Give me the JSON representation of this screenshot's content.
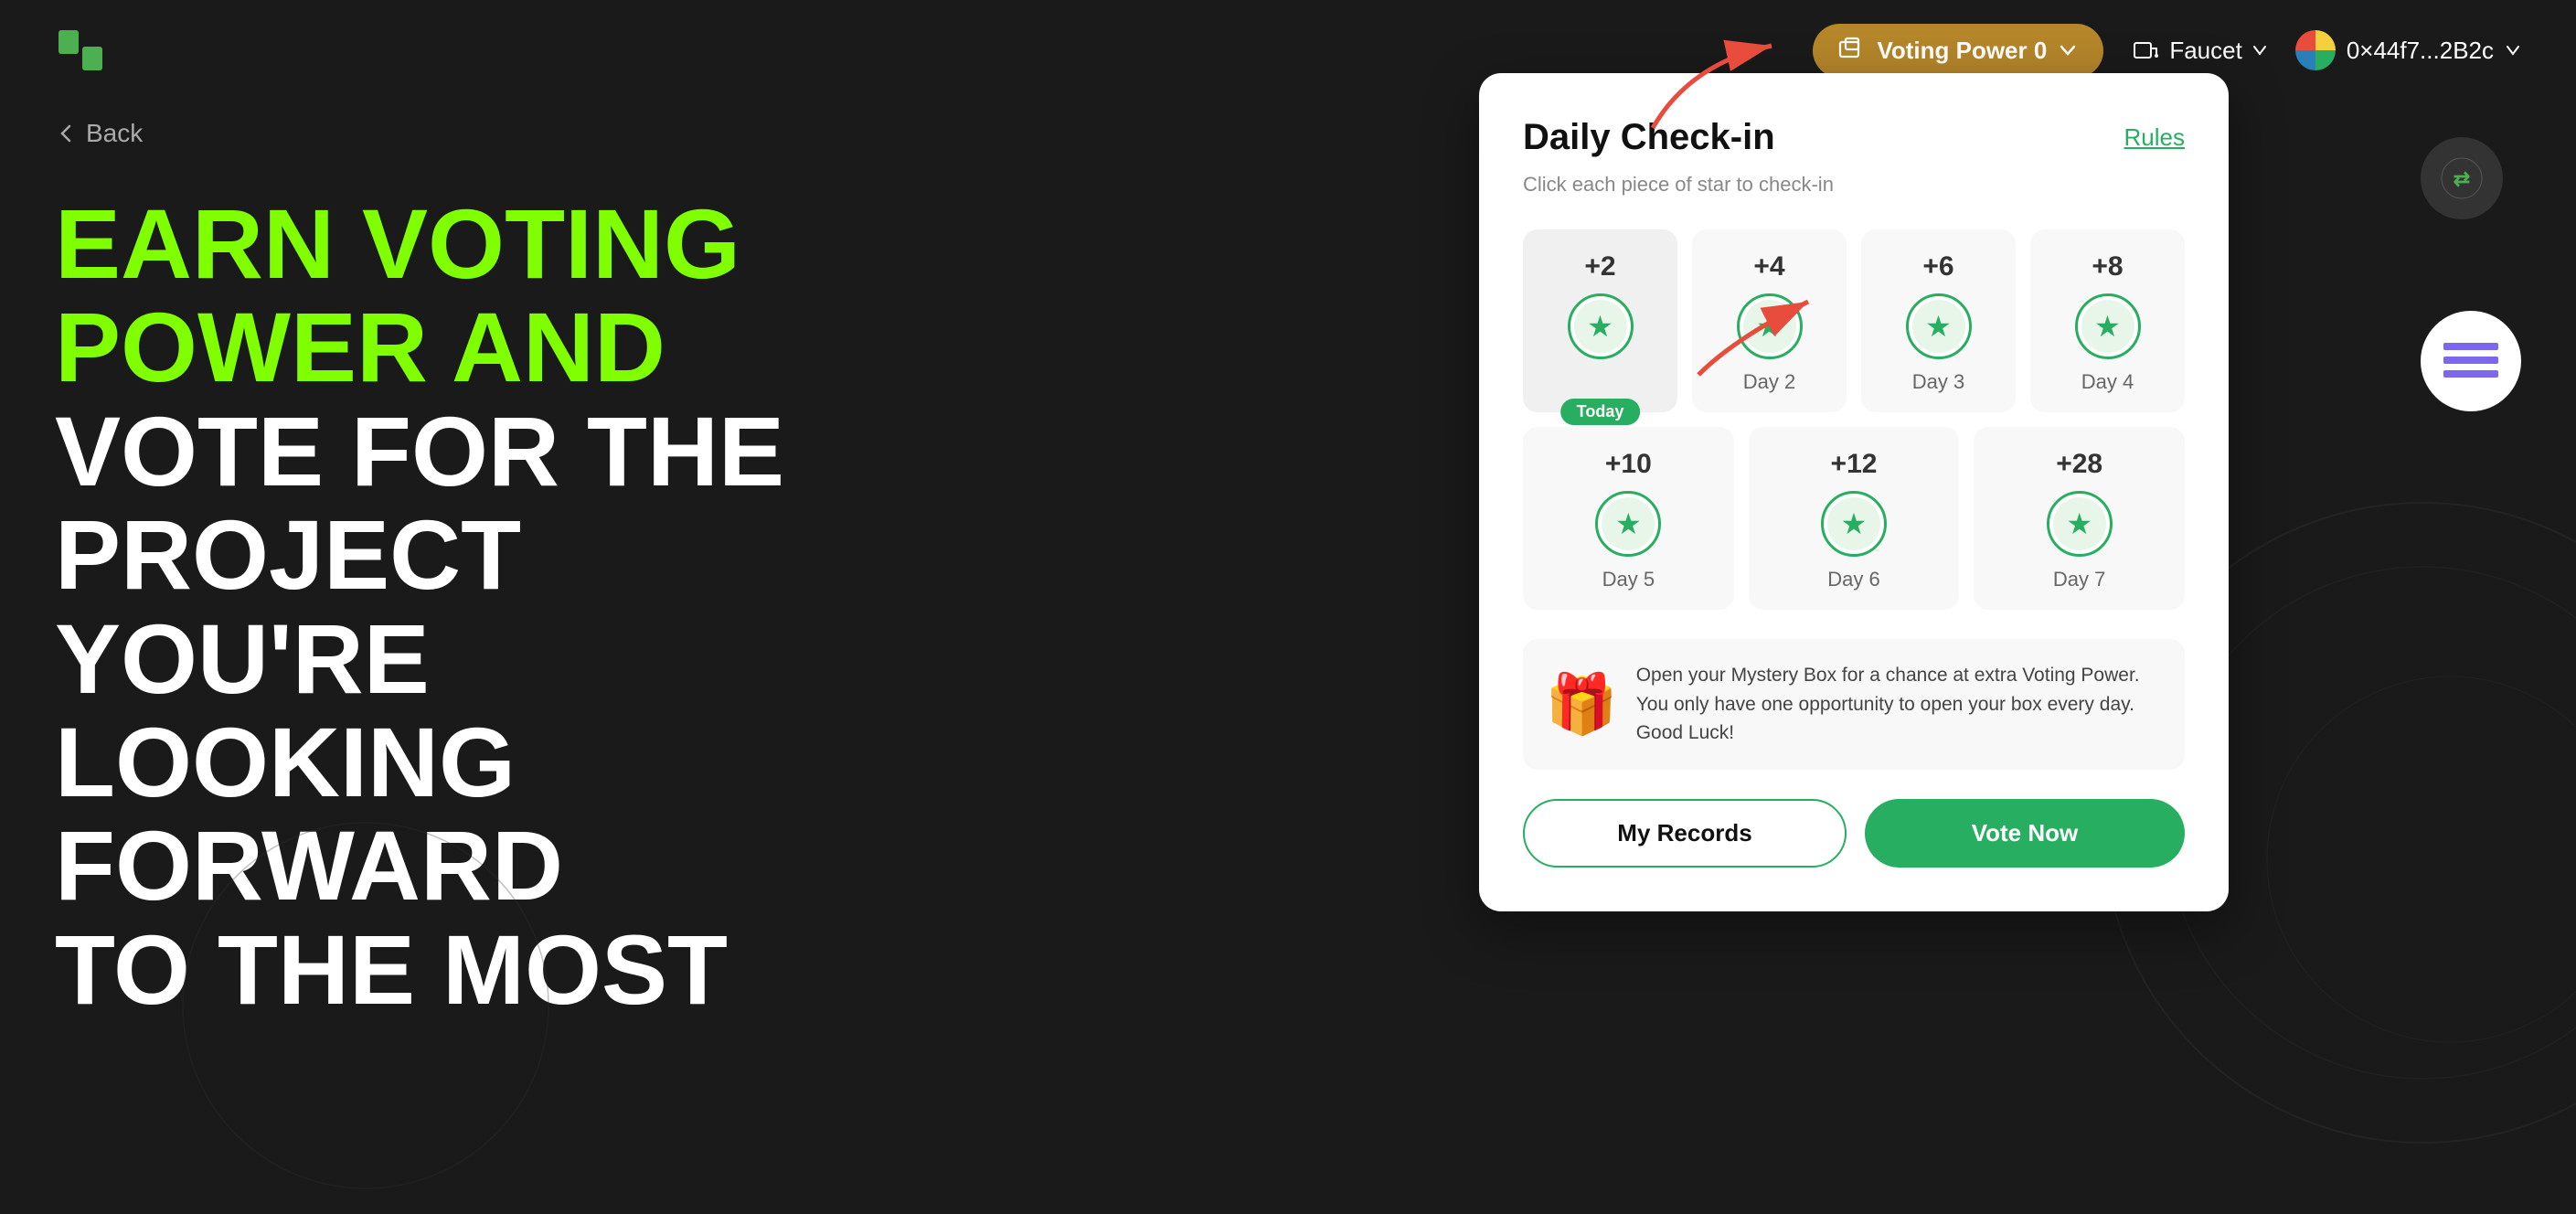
{
  "header": {
    "voting_power_label": "Voting Power 0",
    "faucet_label": "Faucet",
    "wallet_label": "0×44f7...2B2c"
  },
  "nav": {
    "back_label": "Back"
  },
  "headline": {
    "line1": "EARN VOTING",
    "line2": "POWER AND",
    "line3": "VOTE FOR THE",
    "line4": "PROJECT YOU'RE",
    "line5": "LOOKING FORWARD",
    "line6": "TO THE MOST"
  },
  "checkin": {
    "title": "Daily Check-in",
    "rules_label": "Rules",
    "subtitle": "Click each piece of star to check-in",
    "days": [
      {
        "points": "+2",
        "label": "Today",
        "is_today": true
      },
      {
        "points": "+4",
        "label": "Day 2",
        "is_today": false
      },
      {
        "points": "+6",
        "label": "Day 3",
        "is_today": false
      },
      {
        "points": "+8",
        "label": "Day 4",
        "is_today": false
      },
      {
        "points": "+10",
        "label": "Day 5",
        "is_today": false
      },
      {
        "points": "+12",
        "label": "Day 6",
        "is_today": false
      },
      {
        "points": "+28",
        "label": "Day 7",
        "is_today": false
      }
    ],
    "mystery_box_text": "Open your Mystery Box for a chance at extra Voting Power. You only have one opportunity to open your box every day. Good Luck!",
    "my_records_label": "My Records",
    "vote_now_label": "Vote Now",
    "today_badge": "Today"
  }
}
